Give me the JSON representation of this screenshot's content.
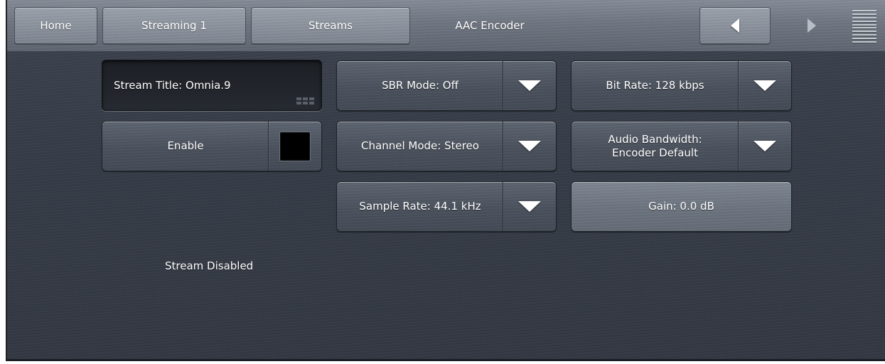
{
  "nav": {
    "home": "Home",
    "streaming": "Streaming 1",
    "streams": "Streams",
    "current": "AAC Encoder",
    "back_icon": "arrow-left-icon",
    "forward_icon": "arrow-right-icon",
    "menu_icon": "hamburger-menu-icon"
  },
  "settings": {
    "stream_title": "Stream Title: Omnia.9",
    "enable_label": "Enable",
    "enable_state": "off",
    "sbr_mode": "SBR Mode: Off",
    "channel_mode": "Channel Mode: Stereo",
    "sample_rate": "Sample Rate: 44.1 kHz",
    "bit_rate": "Bit Rate: 128 kbps",
    "audio_bandwidth_line1": "Audio Bandwidth:",
    "audio_bandwidth_line2": "Encoder Default",
    "gain": "Gain: 0.0 dB"
  },
  "status": {
    "text": "Stream Disabled"
  },
  "colors": {
    "panel_bg": "#363c47",
    "topbar_bg": "#6f7681",
    "text": "#ffffff",
    "indicator_off": "#000000"
  }
}
